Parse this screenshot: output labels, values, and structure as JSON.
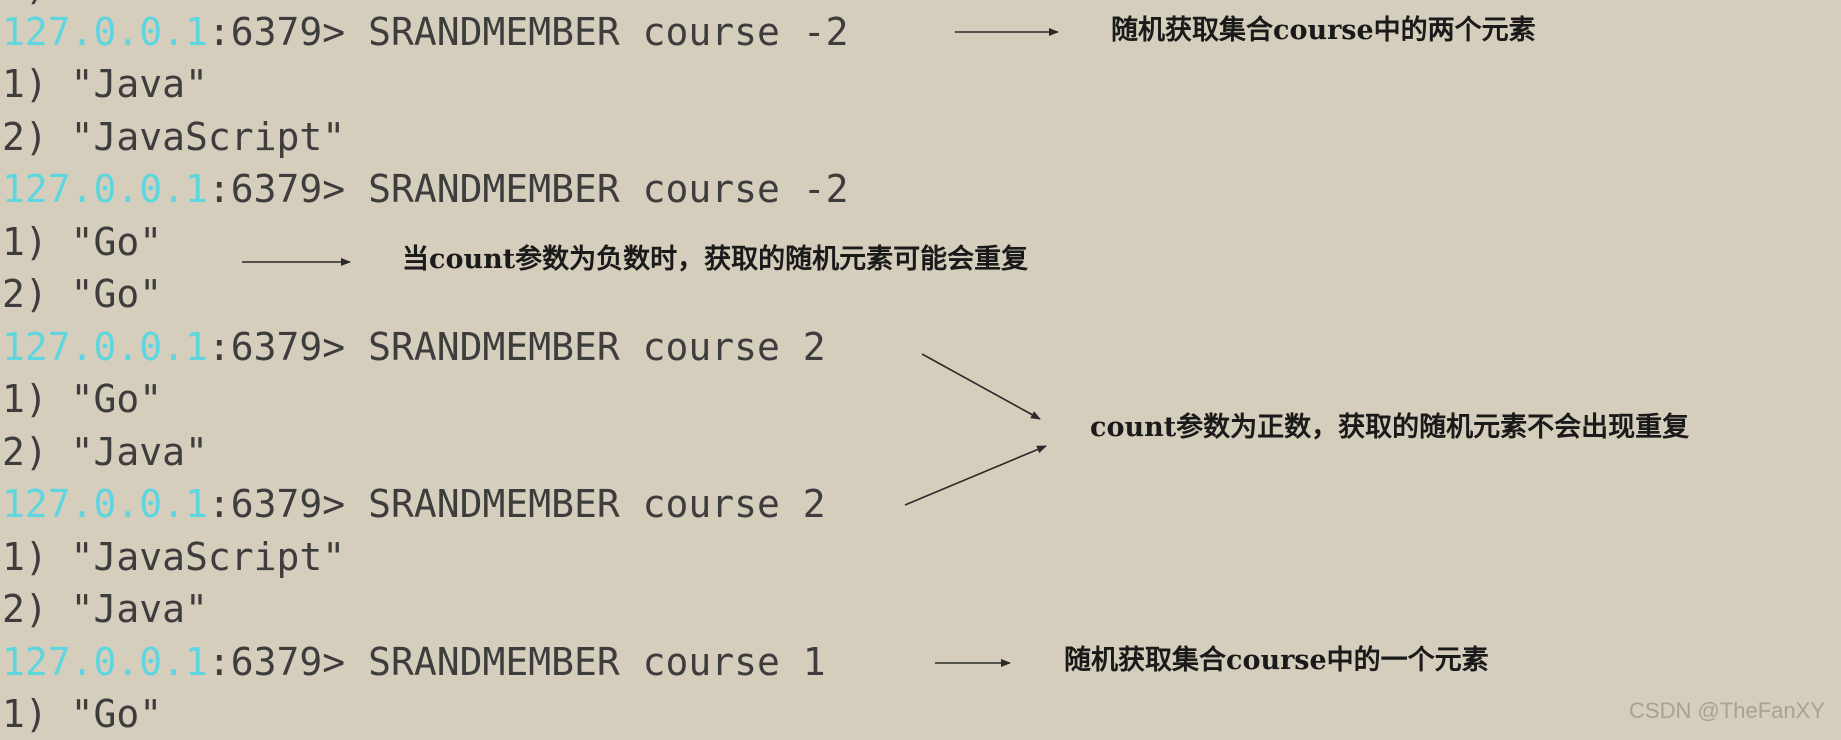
{
  "terminal": {
    "partial_top_line": "1)",
    "prompt_ip": "127.0.0.1",
    "prompt_port": ":6379>",
    "lines": [
      {
        "kind": "prompt",
        "command": " SRANDMEMBER course -2"
      },
      {
        "kind": "output",
        "text": "1) \"Java\""
      },
      {
        "kind": "output",
        "text": "2) \"JavaScript\""
      },
      {
        "kind": "prompt",
        "command": " SRANDMEMBER course -2"
      },
      {
        "kind": "output",
        "text": "1) \"Go\""
      },
      {
        "kind": "output",
        "text": "2) \"Go\""
      },
      {
        "kind": "prompt",
        "command": " SRANDMEMBER course 2"
      },
      {
        "kind": "output",
        "text": "1) \"Go\""
      },
      {
        "kind": "output",
        "text": "2) \"Java\""
      },
      {
        "kind": "prompt",
        "command": " SRANDMEMBER course 2"
      },
      {
        "kind": "output",
        "text": "1) \"JavaScript\""
      },
      {
        "kind": "output",
        "text": "2) \"Java\""
      },
      {
        "kind": "prompt",
        "command": " SRANDMEMBER course 1"
      },
      {
        "kind": "output",
        "text": "1) \"Go\""
      }
    ]
  },
  "annotations": {
    "note_1": "随机获取集合course中的两个元素",
    "note_2": "当count参数为负数时，获取的随机元素可能会重复",
    "note_3": "count参数为正数，获取的随机元素不会出现重复",
    "note_4": "随机获取集合course中的一个元素"
  },
  "watermark": "CSDN @TheFanXY",
  "colors": {
    "background": "#d6cebc",
    "prompt_ip": "#5ed6e0",
    "text": "#3d3d3d",
    "annotation": "#1a1a1a",
    "arrow": "#2a2a2a"
  }
}
